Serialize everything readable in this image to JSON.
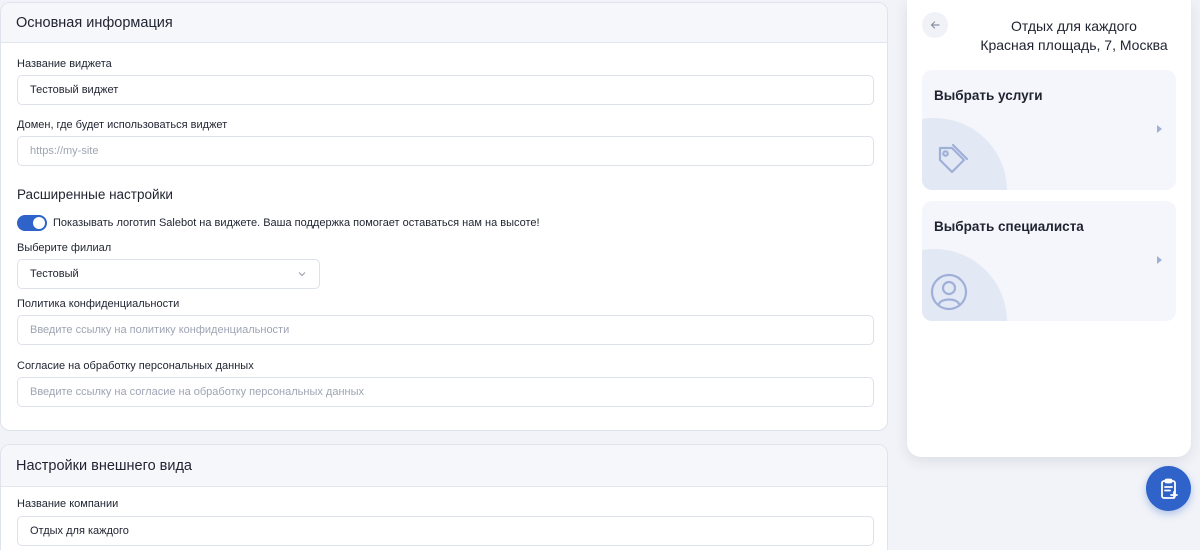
{
  "main_section": {
    "title": "Основная информация",
    "widget_name": {
      "label": "Название виджета",
      "value": "Тестовый виджет"
    },
    "domain": {
      "label": "Домен, где будет использоваться виджет",
      "placeholder": "https://my-site"
    },
    "advanced": {
      "title": "Расширенные настройки",
      "logo_toggle": {
        "text": "Показывать логотип Salebot на виджете. Ваша поддержка помогает оставаться нам на высоте!",
        "on": true
      },
      "branch": {
        "label": "Выберите филиал",
        "value": "Тестовый"
      },
      "privacy": {
        "label": "Политика конфиденциальности",
        "placeholder": "Введите ссылку на политику конфиденциальности"
      },
      "consent": {
        "label": "Согласие на обработку персональных данных",
        "placeholder": "Введите ссылку на согласие на обработку персональных данных"
      }
    }
  },
  "appearance_section": {
    "title": "Настройки внешнего вида",
    "company_name": {
      "label": "Название компании",
      "value": "Отдых для каждого"
    }
  },
  "preview": {
    "title": "Отдых для каждого",
    "subtitle": "Красная площадь, 7, Москва",
    "cards": [
      {
        "label": "Выбрать услуги",
        "icon": "tag-icon"
      },
      {
        "label": "Выбрать специалиста",
        "icon": "user-circle-icon"
      }
    ]
  },
  "colors": {
    "accent": "#2f63c9",
    "icon": "#9fb0d8"
  }
}
